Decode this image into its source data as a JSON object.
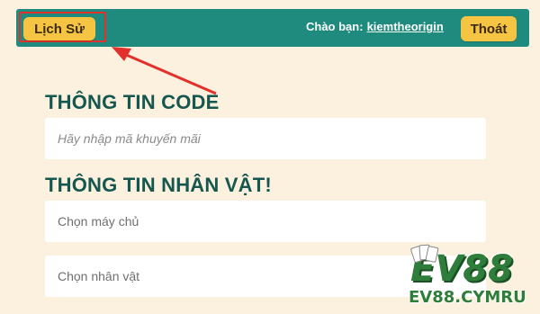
{
  "header": {
    "history_label": "Lịch Sử",
    "greeting_prefix": "Chào bạn:",
    "username": "kiemtheorigin",
    "logout_label": "Thoát",
    "bar_color": "#1f8a7e",
    "button_color": "#f6c443"
  },
  "code_section": {
    "title": "THÔNG TIN CODE",
    "input_placeholder": "Hãy nhập mã khuyến mãi"
  },
  "character_section": {
    "title": "THÔNG TIN NHÂN VẬT!",
    "server_select": "Chọn máy chủ",
    "character_select": "Chọn nhân vật"
  },
  "watermark": {
    "brand": "EV88",
    "domain": "EV88.CYMRU"
  },
  "annotation": {
    "highlight_color": "#e2302a",
    "icon": "red-arrow-icon"
  }
}
